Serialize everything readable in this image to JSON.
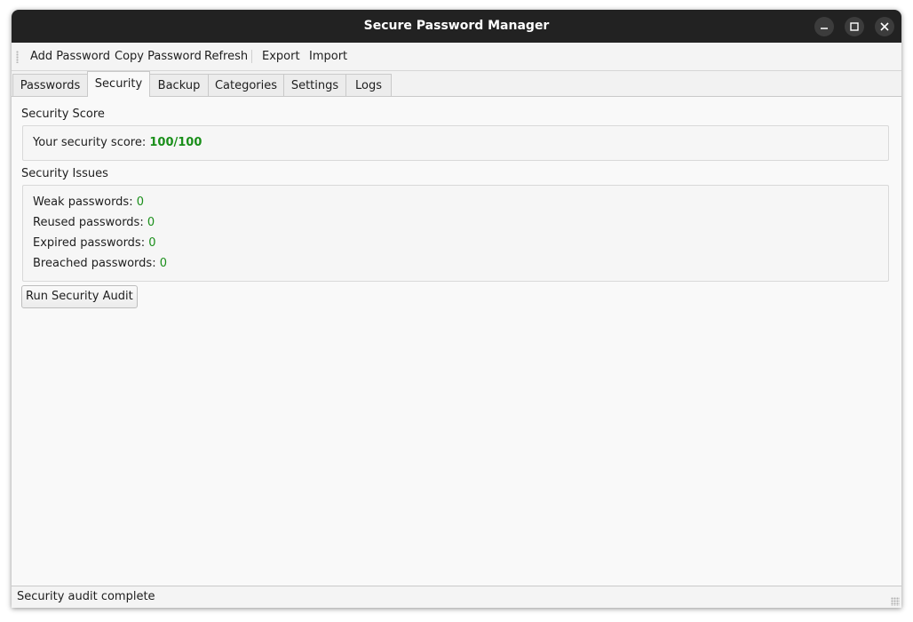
{
  "window": {
    "title": "Secure Password Manager",
    "controls": {
      "minimize_icon": "minimize-icon",
      "maximize_icon": "maximize-icon",
      "close_icon": "close-icon"
    }
  },
  "toolbar": {
    "add_password": "Add Password",
    "copy_password": "Copy Password",
    "refresh": "Refresh",
    "export": "Export",
    "import": "Import"
  },
  "tabs": [
    {
      "label": "Passwords",
      "active": false
    },
    {
      "label": "Security",
      "active": true
    },
    {
      "label": "Backup",
      "active": false
    },
    {
      "label": "Categories",
      "active": false
    },
    {
      "label": "Settings",
      "active": false
    },
    {
      "label": "Logs",
      "active": false
    }
  ],
  "security": {
    "score_section_title": "Security Score",
    "score_label": "Your security score:",
    "score_value": "100/100",
    "issues_section_title": "Security Issues",
    "issues": [
      {
        "label": "Weak passwords:",
        "value": "0"
      },
      {
        "label": "Reused passwords:",
        "value": "0"
      },
      {
        "label": "Expired passwords:",
        "value": "0"
      },
      {
        "label": "Breached passwords:",
        "value": "0"
      }
    ],
    "audit_button": "Run Security Audit"
  },
  "status": {
    "text": "Security audit complete"
  },
  "colors": {
    "good": "#1a8f1a",
    "titlebar": "#222222"
  }
}
